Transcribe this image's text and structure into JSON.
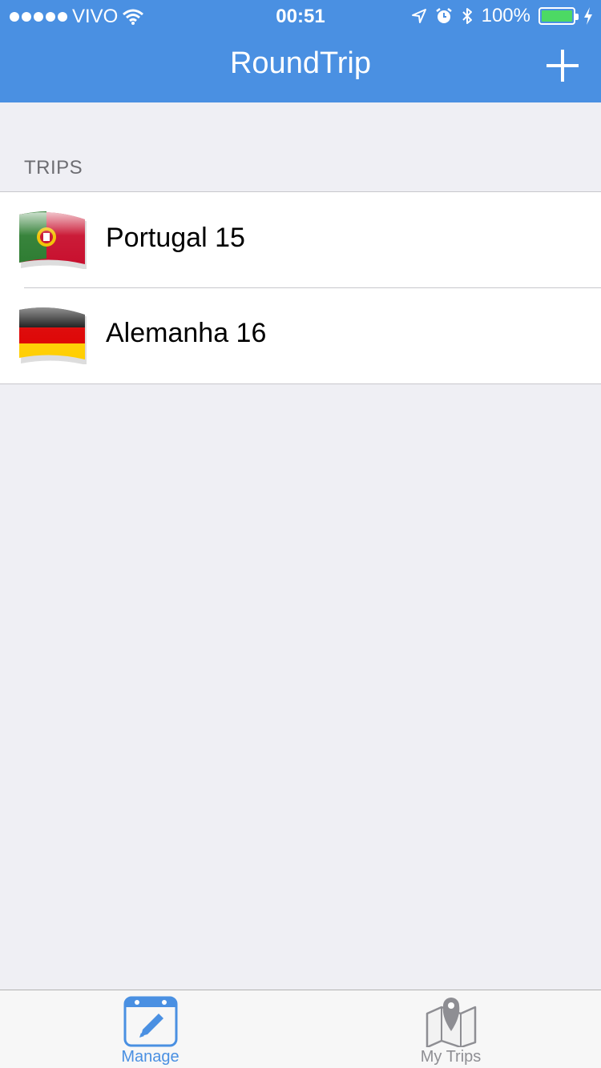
{
  "status_bar": {
    "carrier": "VIVO",
    "time": "00:51",
    "battery": "100%",
    "battery_level": 1.0,
    "battery_color": "#4cd964"
  },
  "nav": {
    "title": "RoundTrip",
    "add_icon": "plus-icon",
    "bar_color": "#4a90e2"
  },
  "section": {
    "header": "TRIPS"
  },
  "trips": [
    {
      "name": "Portugal 15",
      "flag_icon": "portugal-flag-icon"
    },
    {
      "name": "Alemanha 16",
      "flag_icon": "germany-flag-icon"
    }
  ],
  "tab_bar": {
    "tabs": [
      {
        "label": "Manage",
        "icon": "calendar-edit-icon",
        "selected": true
      },
      {
        "label": "My Trips",
        "icon": "map-pin-icon",
        "selected": false
      }
    ],
    "selected_color": "#4a90e2",
    "unselected_color": "#8e8e93"
  }
}
